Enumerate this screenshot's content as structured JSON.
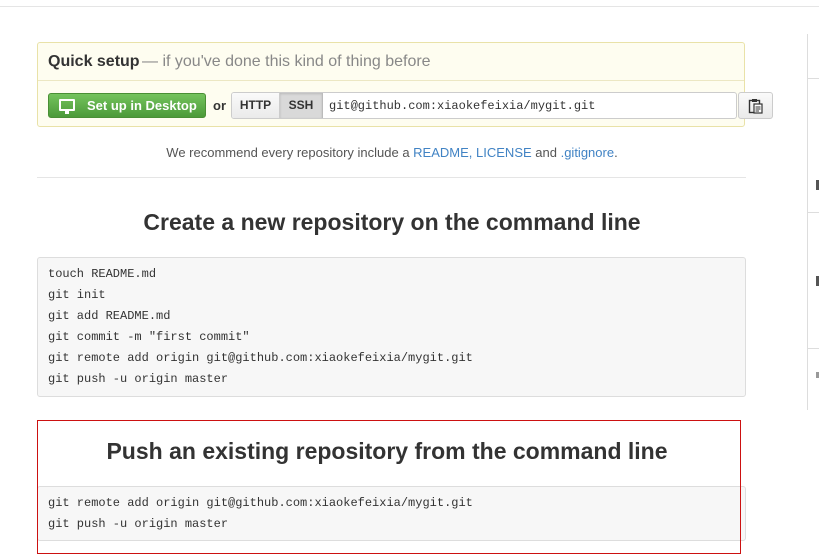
{
  "quick_setup": {
    "title": "Quick setup",
    "subtitle": "— if you've done this kind of thing before",
    "desktop_button": "Set up in Desktop",
    "or": "or",
    "protocols": [
      "HTTP",
      "SSH"
    ],
    "selected_protocol": "SSH",
    "clone_url": "git@github.com:xiaokefeixia/mygit.git"
  },
  "recommend": {
    "prefix": "We recommend every repository include a ",
    "links": [
      "README",
      "LICENSE"
    ],
    "and": " and ",
    "gitignore": ".gitignore",
    "suffix": "."
  },
  "sections": [
    {
      "title": "Create a new repository on the command line",
      "lines": [
        "touch README.md",
        "git init",
        "git add README.md",
        "git commit -m \"first commit\"",
        "git remote add origin git@github.com:xiaokefeixia/mygit.git",
        "git push -u origin master"
      ]
    },
    {
      "title": "Push an existing repository from the command line",
      "lines": [
        "git remote add origin git@github.com:xiaokefeixia/mygit.git",
        "git push -u origin master"
      ]
    }
  ],
  "colors": {
    "accent_link": "#4183c4",
    "desktop_green": "#5aab44",
    "highlight_red": "#cc1111"
  }
}
